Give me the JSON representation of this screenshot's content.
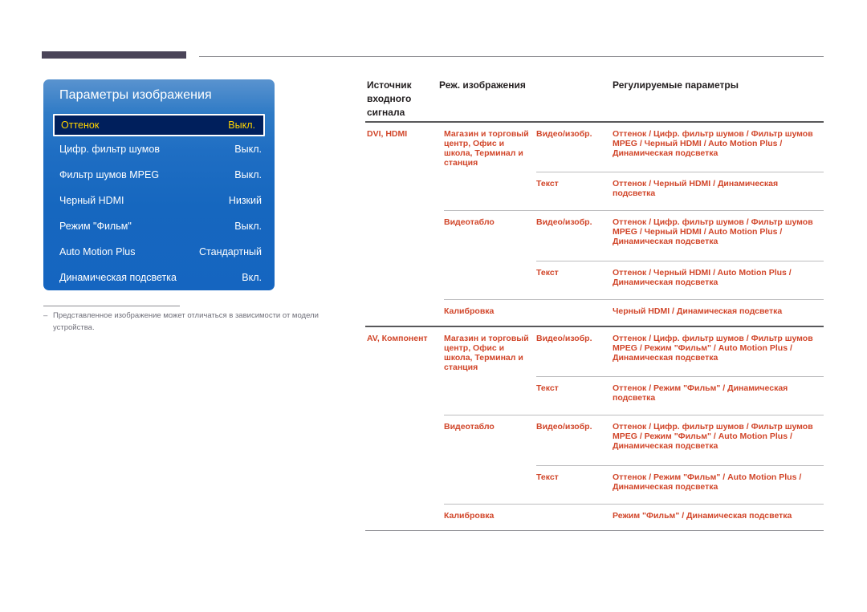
{
  "page": {
    "note_dash": "–",
    "note_text": "Представленное изображение может отличаться в зависимости от модели устройства."
  },
  "osd": {
    "title": "Параметры изображения",
    "items": [
      {
        "label": "Оттенок",
        "value": "Выкл.",
        "selected": true
      },
      {
        "label": "Цифр. фильтр шумов",
        "value": "Выкл.",
        "selected": false
      },
      {
        "label": "Фильтр шумов MPEG",
        "value": "Выкл.",
        "selected": false
      },
      {
        "label": "Черный HDMI",
        "value": "Низкий",
        "selected": false
      },
      {
        "label": "Режим \"Фильм\"",
        "value": "Выкл.",
        "selected": false
      },
      {
        "label": "Auto Motion Plus",
        "value": "Стандартный",
        "selected": false
      },
      {
        "label": "Динамическая подсветка",
        "value": "Вкл.",
        "selected": false
      }
    ]
  },
  "table": {
    "headers": {
      "source": "Источник входного сигнала",
      "mode": "Реж. изображения",
      "params": "Регулируемые параметры"
    },
    "groups": [
      {
        "source": "DVI, HDMI",
        "modes": [
          {
            "mode": "Магазин и торговый центр, Офис и школа, Терминал и станция",
            "rows": [
              {
                "picture": "Видео/изобр.",
                "params": "Оттенок / Цифр. фильтр шумов / Фильтр шумов MPEG / Черный HDMI / Auto Motion Plus / Динамическая подсветка"
              },
              {
                "picture": "Текст",
                "params": "Оттенок / Черный HDMI / Динамическая подсветка"
              }
            ]
          },
          {
            "mode": "Видеотабло",
            "rows": [
              {
                "picture": "Видео/изобр.",
                "params": "Оттенок / Цифр. фильтр шумов / Фильтр шумов MPEG / Черный HDMI / Auto Motion Plus / Динамическая подсветка"
              },
              {
                "picture": "Текст",
                "params": "Оттенок / Черный HDMI / Auto Motion Plus / Динамическая подсветка"
              }
            ]
          },
          {
            "mode": "Калибровка",
            "rows": [
              {
                "picture": "",
                "params": "Черный HDMI / Динамическая подсветка"
              }
            ]
          }
        ]
      },
      {
        "source": "AV, Компонент",
        "modes": [
          {
            "mode": "Магазин и торговый центр, Офис и школа, Терминал и станция",
            "rows": [
              {
                "picture": "Видео/изобр.",
                "params": "Оттенок / Цифр. фильтр шумов / Фильтр шумов MPEG / Режим \"Фильм\" / Auto Motion Plus / Динамическая подсветка"
              },
              {
                "picture": "Текст",
                "params": "Оттенок / Режим \"Фильм\" / Динамическая подсветка"
              }
            ]
          },
          {
            "mode": "Видеотабло",
            "rows": [
              {
                "picture": "Видео/изобр.",
                "params": "Оттенок / Цифр. фильтр шумов / Фильтр шумов MPEG / Режим \"Фильм\" / Auto Motion Plus / Динамическая подсветка"
              },
              {
                "picture": "Текст",
                "params": "Оттенок / Режим \"Фильм\" / Auto Motion Plus / Динамическая подсветка"
              }
            ]
          },
          {
            "mode": "Калибровка",
            "rows": [
              {
                "picture": "",
                "params": "Режим \"Фильм\" / Динамическая подсветка"
              }
            ]
          }
        ]
      }
    ]
  },
  "colors": {
    "table_text": "#d1462a",
    "header_text": "#231f20",
    "osd_panel_blue": "#1565c0",
    "osd_selected_bg": "#001f5c",
    "osd_selected_text": "#ffd400",
    "top_bar": "#4a4458"
  }
}
